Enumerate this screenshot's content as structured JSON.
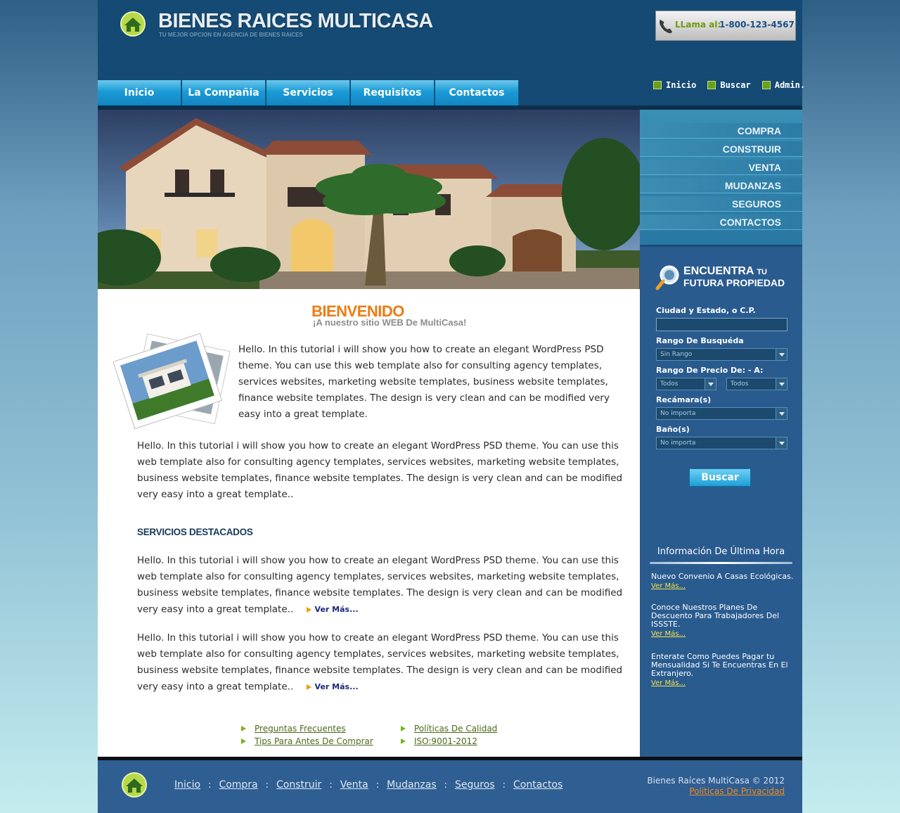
{
  "header": {
    "brand_title": "BIENES RAICES MULTICASA",
    "brand_tagline": "TU MEJOR OPCION EN AGENCIA DE BIENES RAICES",
    "phone_label": "LLama al:",
    "phone_number": "1-800-123-4567"
  },
  "main_nav": [
    {
      "label": "Inicio"
    },
    {
      "label": "La Compañia"
    },
    {
      "label": "Servicios"
    },
    {
      "label": "Requisitos"
    },
    {
      "label": "Contactos"
    }
  ],
  "quick_links": [
    {
      "label": "Inicio"
    },
    {
      "label": "Buscar"
    },
    {
      "label": "Admin."
    }
  ],
  "side_menu": [
    {
      "label": "COMPRA"
    },
    {
      "label": "CONSTRUIR"
    },
    {
      "label": "VENTA"
    },
    {
      "label": "MUDANZAS"
    },
    {
      "label": "SEGUROS"
    },
    {
      "label": "CONTACTOS"
    }
  ],
  "search": {
    "title_line1": "ENCUENTRA",
    "title_line1_small": "TU",
    "title_line2": "FUTURA PROPIEDAD",
    "city_label": "Ciudad y Estado, o C.P.",
    "city_value": "",
    "range_label": "Rango De Busquéda",
    "range_value": "Sin Rango",
    "price_label": "Rango De Precio De:   -    A:",
    "price_from": "Todos",
    "price_to": "Todos",
    "bedrooms_label": "Recámara(s)",
    "bedrooms_value": "No importa",
    "bathrooms_label": "Baño(s)",
    "bathrooms_value": "No importa",
    "button_label": "Buscar"
  },
  "news": {
    "title": "Información De Última Hora",
    "items": [
      {
        "text": "Nuevo Convenio A Casas Ecológicas.",
        "more": "Ver Más..."
      },
      {
        "text": "Conoce Nuestros Planes De Descuento Para Trabajadores Del ISSSTE.",
        "more": "Ver Más..."
      },
      {
        "text": "Enterate Como Puedes Pagar tu Mensualidad Si Te Encuentras En El Extranjero.",
        "more": "Ver Más..."
      }
    ]
  },
  "content": {
    "welcome_title": "BIENVENIDO",
    "welcome_subtitle": "¡A nuestro sitio WEB De MultiCasa!",
    "paragraph_1": "Hello. In this tutorial i will show you how to create an elegant WordPress PSD theme. You can use this web template also for consulting agency templates, services websites, marketing website templates, business website templates, finance website templates. The design is very clean and can be modified very easy into a great template.",
    "paragraph_2": "Hello. In this tutorial i will show you how to create an elegant WordPress PSD theme. You can use this web template also for consulting agency templates, services websites, marketing website templates, business website templates, finance website templates. The design is very clean and can be modified very easy into a great template..",
    "services_heading": "SERVICIOS DESTACADOS",
    "service_1": "Hello. In this tutorial i will show you how to create an elegant WordPress PSD theme. You can use this web template also for consulting agency templates, services websites, marketing website templates, business website templates, finance website templates. The design is very clean and can be modified very easy into a great template..",
    "service_2": "Hello. In this tutorial i will show you how to create an elegant WordPress PSD theme. You can use this web template also for consulting agency templates, services websites, marketing website templates, business website templates, finance website templates. The design is very clean and can be modified very easy into a great template..",
    "ver_mas": "Ver Más..."
  },
  "content_links": [
    {
      "label": "Preguntas Frecuentes"
    },
    {
      "label": "Tips Para Antes De Comprar"
    },
    {
      "label": "Políticas De Calidad"
    },
    {
      "label": "ISO:9001-2012"
    }
  ],
  "footer": {
    "nav": [
      {
        "label": "Inicio"
      },
      {
        "label": "Compra"
      },
      {
        "label": "Construir"
      },
      {
        "label": "Venta"
      },
      {
        "label": "Mudanzas"
      },
      {
        "label": "Seguros"
      },
      {
        "label": "Contactos"
      }
    ],
    "separator": ":",
    "copyright": "Bienes Raíces MultiCasa ©  2012",
    "privacy": "Politicas De Privacidad"
  },
  "colors": {
    "header_bg": "#144a73",
    "accent_orange": "#ec7c12",
    "nav_blue": "#1b9bd6",
    "panel_blue": "#2a5b8f",
    "link_green": "#4a6a1a"
  }
}
